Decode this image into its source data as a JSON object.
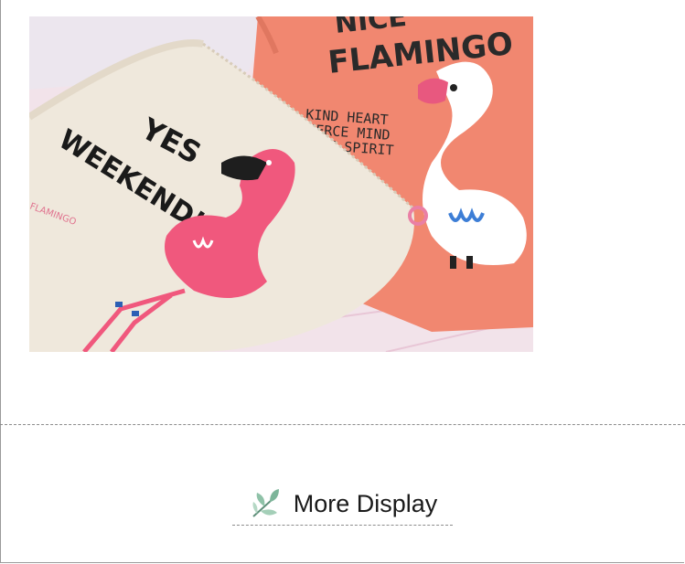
{
  "section": {
    "heading": "More Display",
    "icon": "leaf-sprig-icon",
    "accent_color": "#6fa88a"
  },
  "product_photo": {
    "front_pouch_text_line1": "YES",
    "front_pouch_text_line2": "WEEKEND!",
    "front_pouch_small": "FLAMINGO",
    "back_pouch_title_line1": "NICE",
    "back_pouch_title_line2": "FLAMINGO",
    "back_pouch_line1": "KIND HEART",
    "back_pouch_line2": "FIERCE MIND",
    "back_pouch_line3": "BRAVE SPIRIT"
  }
}
